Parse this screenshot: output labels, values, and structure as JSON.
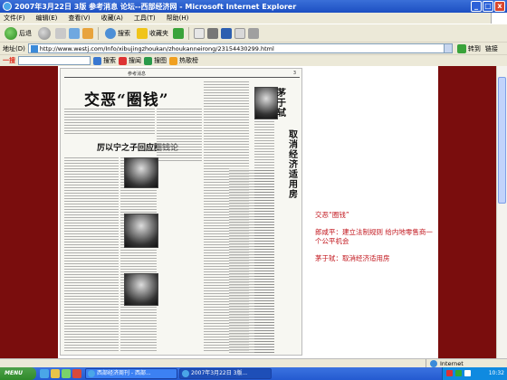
{
  "window": {
    "title": "2007年3月22日 3版 参考消息 论坛--西部经济网 - Microsoft Internet Explorer",
    "controls": {
      "minimize": "_",
      "maximize": "□",
      "close": "x"
    }
  },
  "menu": [
    "文件(F)",
    "编辑(E)",
    "查看(V)",
    "收藏(A)",
    "工具(T)",
    "帮助(H)"
  ],
  "toolbar": {
    "back_label": "后退",
    "search_label": "搜索",
    "favorites_label": "收藏夹"
  },
  "address": {
    "label": "地址(D)",
    "url": "http://www.westj.com/Info/xibujingzhoukan/zhoukanneirong/23154430299.html",
    "go_label": "转到",
    "links_label": "链接"
  },
  "search_toolbar": {
    "logo": "一搜",
    "search_label": "搜索",
    "news_label": "搜闻",
    "image_label": "搜图",
    "hot_label": "热歌榜"
  },
  "newspaper": {
    "header": "参考消息",
    "page_no": "3",
    "headline": "交恶“圈钱”",
    "subhead": "厉以宁之子回应圈钱论",
    "vertical_1": "茅于轼",
    "vertical_2": "取消经济适用房"
  },
  "notes": [
    "交恶“圈钱”",
    "郎咸平：建立法制规则 给内地零售商一个公平机会",
    "茅于轼：取消经济适用房"
  ],
  "status": {
    "zone": "Internet"
  },
  "taskbar": {
    "start": "MENU",
    "tasks": [
      "西部经济周刊 - 西部...",
      "2007年3月22日 3版..."
    ],
    "clock": "10:32"
  }
}
